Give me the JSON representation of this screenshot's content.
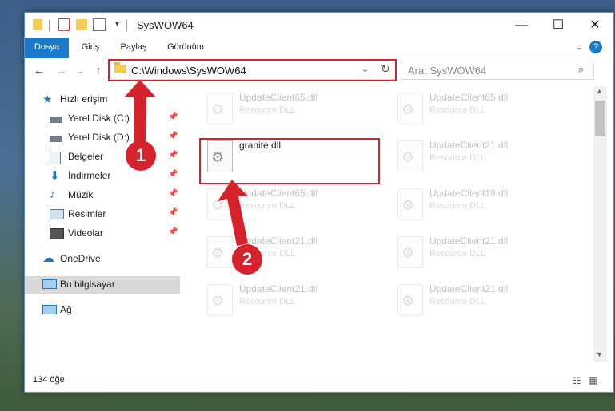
{
  "window": {
    "title": "SysWOW64",
    "controls": [
      "—",
      "☐",
      "✕"
    ]
  },
  "ribbon": {
    "tabs": [
      "Dosya",
      "Giriş",
      "Paylaş",
      "Görünüm"
    ],
    "help_icon": "help-icon"
  },
  "nav": {
    "address": "C:\\Windows\\SysWOW64",
    "search_placeholder": "Ara: SysWOW64"
  },
  "sidebar": {
    "items": [
      {
        "label": "Hızlı erişim",
        "icon": "star-icon"
      },
      {
        "label": "Yerel Disk (C:)",
        "icon": "drive-icon"
      },
      {
        "label": "Yerel Disk (D:)",
        "icon": "drive-icon"
      },
      {
        "label": "Belgeler",
        "icon": "documents-icon"
      },
      {
        "label": "İndirmeler",
        "icon": "download-icon"
      },
      {
        "label": "Müzik",
        "icon": "music-icon"
      },
      {
        "label": "Resimler",
        "icon": "pictures-icon"
      },
      {
        "label": "Videolar",
        "icon": "video-icon"
      },
      {
        "label": "OneDrive",
        "icon": "cloud-icon"
      },
      {
        "label": "Bu bilgisayar",
        "icon": "computer-icon"
      },
      {
        "label": "Ağ",
        "icon": "network-icon"
      }
    ]
  },
  "files": [
    {
      "name": "UpdateClient65.dll",
      "type": "Resource DLL"
    },
    {
      "name": "UpdateClient65.dll",
      "type": "Resource DLL"
    },
    {
      "name": "granite.dll",
      "type": ""
    },
    {
      "name": "UpdateClient21.dll",
      "type": "Resource DLL"
    },
    {
      "name": "UpdateClient65.dll",
      "type": "Resource DLL"
    },
    {
      "name": "UpdateClient19.dll",
      "type": "Resource DLL"
    },
    {
      "name": "UpdateClient21.dll",
      "type": "Resource DLL"
    },
    {
      "name": "UpdateClient21.dll",
      "type": "Resource DLL"
    },
    {
      "name": "UpdateClient21.dll",
      "type": "Resource DLL"
    },
    {
      "name": "UpdateClient21.dll",
      "type": "Resource DLL"
    }
  ],
  "status": {
    "count": "134 öğe"
  },
  "annotations": {
    "step1": "1",
    "step2": "2"
  },
  "colors": {
    "accent": "#1979ca",
    "highlight": "#d6222a"
  }
}
